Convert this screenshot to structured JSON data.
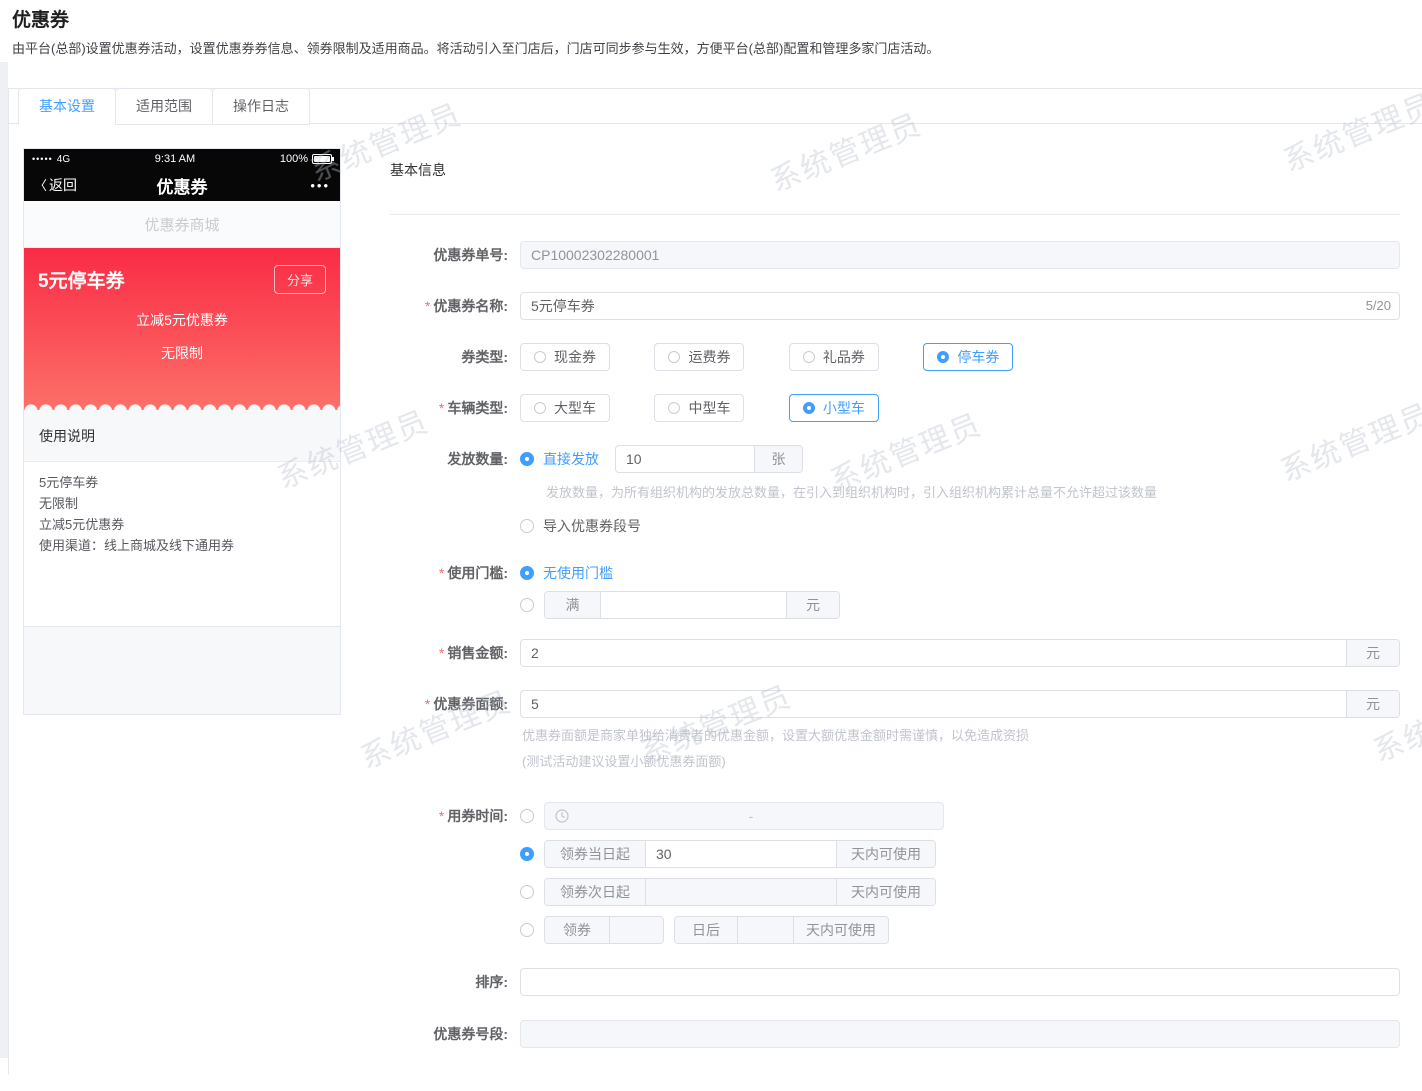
{
  "page": {
    "title": "优惠券",
    "description": "由平台(总部)设置优惠券活动，设置优惠券券信息、领券限制及适用商品。将活动引入至门店后，门店可同步参与生效，方便平台(总部)配置和管理多家门店活动。",
    "watermark": "系统管理员",
    "required_mark": "*"
  },
  "tabs": [
    {
      "label": "基本设置",
      "active": true
    },
    {
      "label": "适用范围",
      "active": false
    },
    {
      "label": "操作日志",
      "active": false
    }
  ],
  "phone": {
    "status": {
      "signal": "•••••",
      "network": "4G",
      "time": "9:31 AM",
      "battery": "100%"
    },
    "nav": {
      "back_arrow": "〈",
      "back": "返回",
      "title": "优惠券",
      "more": "•••"
    },
    "banner": "优惠券商城",
    "coupon": {
      "title": "5元停车券",
      "share_button": "分享",
      "discount": "立减5元优惠券",
      "limit": "无限制"
    },
    "usage": {
      "title": "使用说明",
      "lines": [
        "5元停车券",
        "无限制",
        "立减5元优惠券",
        "使用渠道：线上商城及线下通用券"
      ]
    }
  },
  "form": {
    "section_title": "基本信息",
    "coupon_no": {
      "label": "优惠券单号:",
      "value": "CP10002302280001",
      "disabled": true
    },
    "coupon_name": {
      "label": "优惠券名称:",
      "required": true,
      "value": "5元停车券",
      "counter": "5/20"
    },
    "coupon_type": {
      "label": "券类型:",
      "options": [
        {
          "label": "现金券",
          "selected": false
        },
        {
          "label": "运费券",
          "selected": false
        },
        {
          "label": "礼品券",
          "selected": false
        },
        {
          "label": "停车券",
          "selected": true
        }
      ]
    },
    "vehicle_type": {
      "label": "车辆类型:",
      "required": true,
      "options": [
        {
          "label": "大型车",
          "selected": false
        },
        {
          "label": "中型车",
          "selected": false
        },
        {
          "label": "小型车",
          "selected": true
        }
      ]
    },
    "issue_qty": {
      "label": "发放数量:",
      "direct_label": "直接发放",
      "value": "10",
      "unit": "张",
      "hint": "发放数量，为所有组织机构的发放总数量，在引入到组织机构时，引入组织机构累计总量不允许超过该数量",
      "import_label": "导入优惠券段号"
    },
    "threshold": {
      "label": "使用门槛:",
      "required": true,
      "none_label": "无使用门槛",
      "min_prefix": "满",
      "unit": "元"
    },
    "sale_amount": {
      "label": "销售金额:",
      "required": true,
      "value": "2",
      "unit": "元"
    },
    "face_value": {
      "label": "优惠券面额:",
      "required": true,
      "value": "5",
      "unit": "元",
      "hint1": "优惠券面额是商家单独给消费者的优惠金额，设置大额优惠金额时需谨慎，以免造成资损",
      "hint2": "(测试活动建议设置小额优惠券面额)"
    },
    "use_time": {
      "label": "用券时间:",
      "required": true,
      "range_separator": "-",
      "day_of": {
        "prefix": "领券当日起",
        "value": "30",
        "suffix": "天内可使用"
      },
      "next_day": {
        "prefix": "领券次日起",
        "suffix": "天内可使用"
      },
      "custom": {
        "p1": "领券",
        "p2": "日后",
        "suffix": "天内可使用"
      }
    },
    "sort": {
      "label": "排序:"
    },
    "segment": {
      "label": "优惠券号段:",
      "disabled": true
    }
  }
}
